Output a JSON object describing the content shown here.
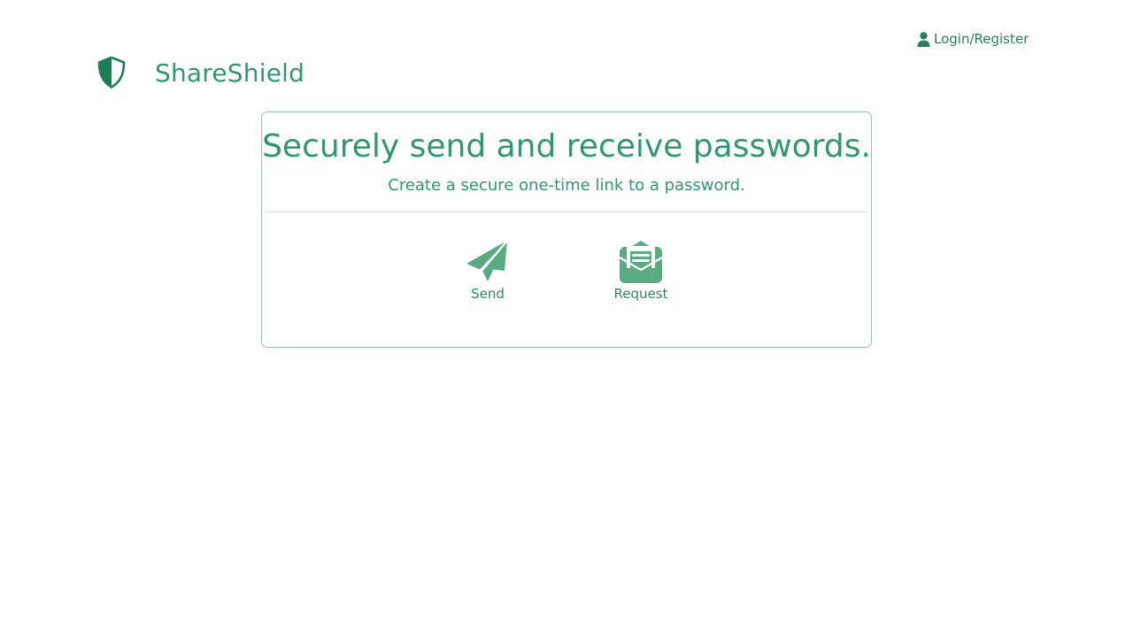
{
  "header": {
    "login_label": "Login/Register",
    "login_icon": "user-icon"
  },
  "brand": {
    "name": "ShareShield",
    "logo_icon": "shield-icon"
  },
  "card": {
    "title": "Securely send and receive passwords.",
    "subtitle": "Create a secure one-time link to a password.",
    "actions": [
      {
        "label": "Send",
        "icon": "paper-plane-icon"
      },
      {
        "label": "Request",
        "icon": "open-envelope-icon"
      }
    ]
  },
  "colors": {
    "brand_green": "#2e9a6a",
    "icon_green": "#5aab84",
    "dark_green": "#2a7f5a",
    "border": "#9bbfb0"
  }
}
